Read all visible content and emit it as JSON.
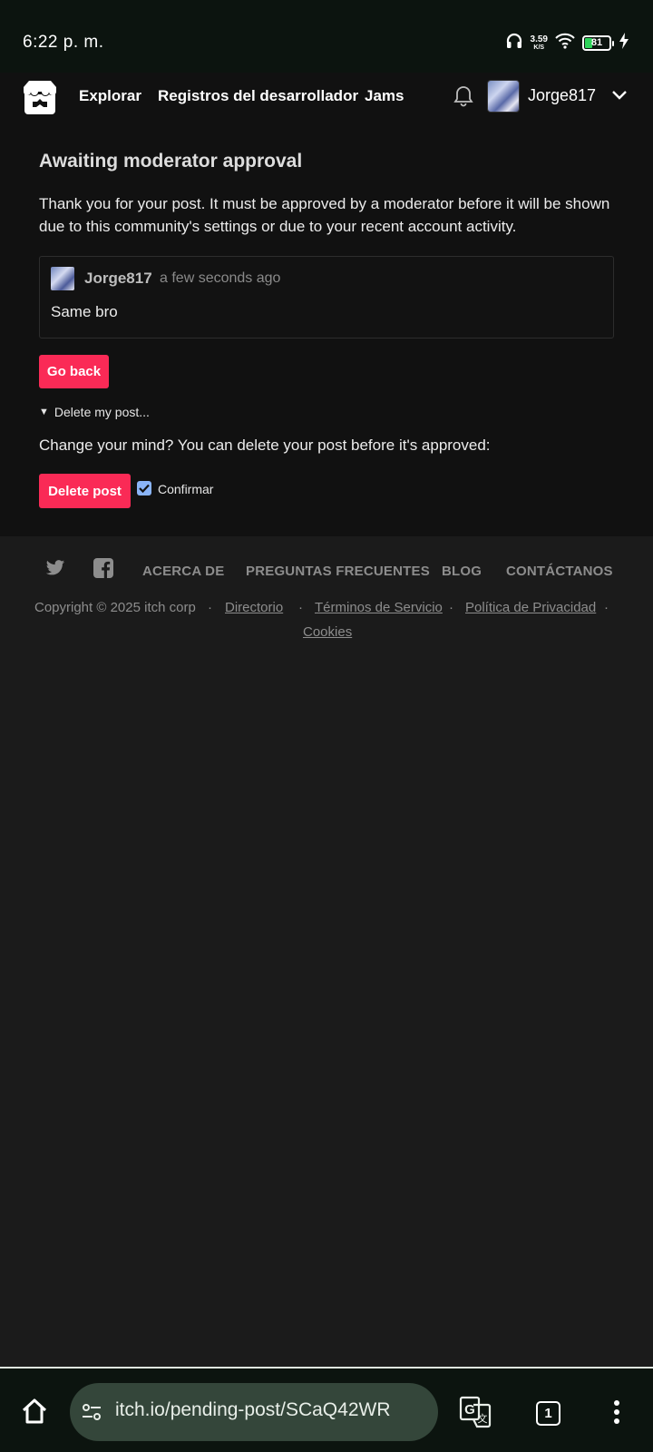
{
  "status_bar": {
    "time": "6:22 p. m.",
    "net_speed_value": "3.59",
    "net_speed_unit": "K/S",
    "battery_level": "81",
    "icons": [
      "headphones-icon",
      "wifi-icon",
      "battery-icon",
      "charging-bolt-icon"
    ]
  },
  "nav": {
    "links": [
      "Explorar",
      "Registros del desarrollador",
      "Jams"
    ],
    "username": "Jorge817",
    "icons": [
      "itchio-logo-icon",
      "bell-icon",
      "avatar",
      "chevron-down-icon"
    ]
  },
  "main": {
    "title": "Awaiting moderator approval",
    "notice": "Thank you for your post. It must be approved by a moderator before it will be shown due to this community's settings or due to your recent account activity.",
    "post": {
      "author": "Jorge817",
      "time": "a few seconds ago",
      "body": "Same bro"
    },
    "go_back_label": "Go back",
    "details_summary": "Delete my post...",
    "change_mind_text": "Change your mind? You can delete your post before it's approved:",
    "delete_label": "Delete post",
    "confirm_label": "Confirmar",
    "confirm_checked": true
  },
  "footer": {
    "links": [
      "ACERCA DE",
      "PREGUNTAS FRECUENTES",
      "BLOG",
      "CONTÁCTANOS"
    ],
    "copyright": "Copyright © 2025 itch corp",
    "legal_links": [
      "Directorio",
      "Términos de Servicio",
      "Política de Privacidad",
      "Cookies"
    ],
    "separator": "·",
    "icons": [
      "twitter-icon",
      "facebook-icon"
    ]
  },
  "browser": {
    "url": "itch.io/pending-post/SCaQ42WR",
    "tab_count": "1",
    "icons": [
      "home-icon",
      "site-settings-icon",
      "translate-icon",
      "tabs-icon",
      "more-menu-icon"
    ]
  },
  "colors": {
    "accent": "#fa2a56",
    "page_bg": "#1b1b1b",
    "panel_bg": "#111111",
    "checkbox": "#8ab4f8"
  }
}
